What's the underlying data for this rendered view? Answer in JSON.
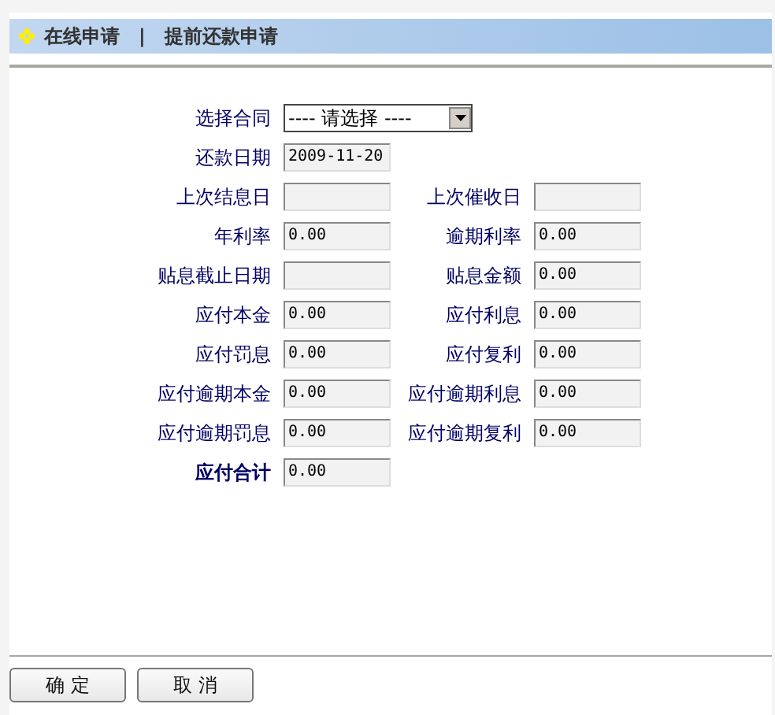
{
  "header": {
    "section": "在线申请",
    "separator": "|",
    "page": "提前还款申请"
  },
  "rows": [
    [
      {
        "label": "选择合同",
        "kind": "select",
        "value": "---- 请选择 ----"
      }
    ],
    [
      {
        "label": "还款日期",
        "kind": "field",
        "value": "2009-11-20"
      }
    ],
    [
      {
        "label": "上次结息日",
        "kind": "field"
      },
      {
        "label": "上次催收日",
        "kind": "field"
      }
    ],
    [
      {
        "label": "年利率",
        "kind": "field",
        "value": "0.00"
      },
      {
        "label": "逾期利率",
        "kind": "field",
        "value": "0.00"
      }
    ],
    [
      {
        "label": "贴息截止日期",
        "kind": "field"
      },
      {
        "label": "贴息金额",
        "kind": "field",
        "value": "0.00"
      }
    ],
    [
      {
        "label": "应付本金",
        "kind": "field",
        "value": "0.00"
      },
      {
        "label": "应付利息",
        "kind": "field",
        "value": "0.00"
      }
    ],
    [
      {
        "label": "应付罚息",
        "kind": "field",
        "value": "0.00"
      },
      {
        "label": "应付复利",
        "kind": "field",
        "value": "0.00"
      }
    ],
    [
      {
        "label": "应付逾期本金",
        "kind": "field",
        "value": "0.00"
      },
      {
        "label": "应付逾期利息",
        "kind": "field",
        "value": "0.00"
      }
    ],
    [
      {
        "label": "应付逾期罚息",
        "kind": "field",
        "value": "0.00"
      },
      {
        "label": "应付逾期复利",
        "kind": "field",
        "value": "0.00"
      }
    ],
    [
      {
        "label": "应付合计",
        "kind": "total",
        "value": "0.00"
      }
    ]
  ],
  "buttons": [
    "确 定",
    "取 消"
  ]
}
